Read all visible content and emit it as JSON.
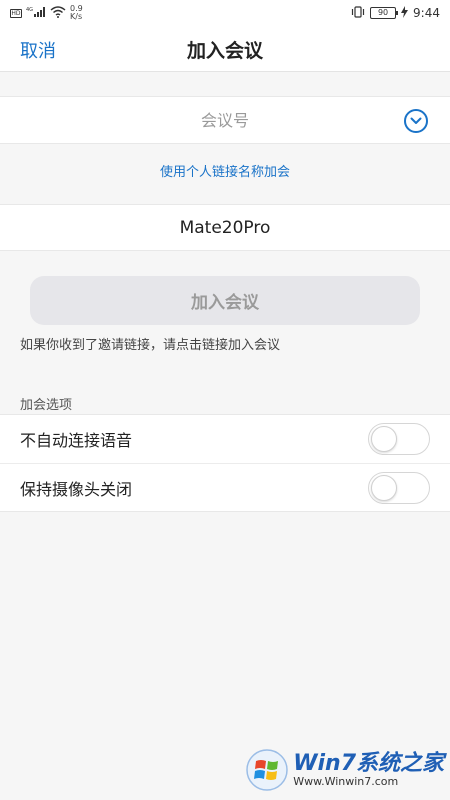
{
  "status_bar": {
    "sim_label": "HD",
    "signal_label": "4G",
    "net_speed_value": "0.9",
    "net_speed_unit": "K/s",
    "battery_level": "90",
    "time": "9:44"
  },
  "nav": {
    "cancel_label": "取消",
    "title": "加入会议"
  },
  "meeting_id": {
    "placeholder": "会议号",
    "value": ""
  },
  "personal_link_label": "使用个人链接名称加会",
  "name_field": {
    "value": "Mate20Pro"
  },
  "join_button_label": "加入会议",
  "hint": "如果你收到了邀请链接，请点击链接加入会议",
  "options": {
    "section_title": "加会选项",
    "items": [
      {
        "label": "不自动连接语音",
        "enabled": false
      },
      {
        "label": "保持摄像头关闭",
        "enabled": false
      }
    ]
  },
  "watermark": {
    "brand": "Win7系统之家",
    "url": "Www.Winwin7.com"
  },
  "colors": {
    "accent": "#1a73c8",
    "background": "#f6f6f6",
    "button_disabled": "#e6e6ea"
  }
}
